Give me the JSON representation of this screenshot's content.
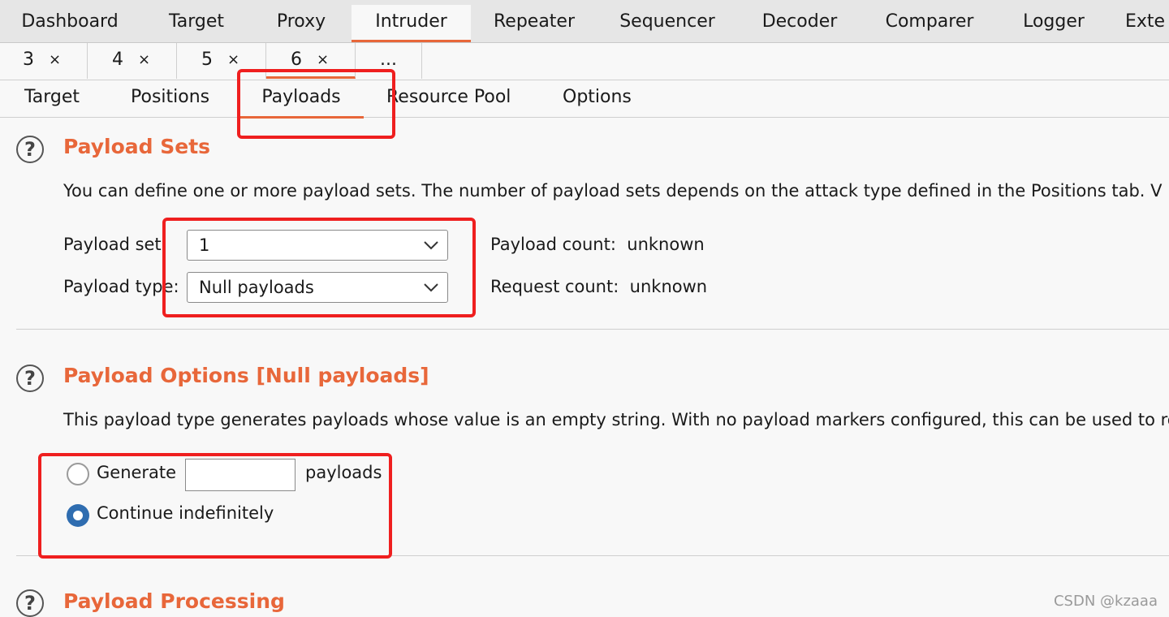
{
  "top_tabs": [
    "Dashboard",
    "Target",
    "Proxy",
    "Intruder",
    "Repeater",
    "Sequencer",
    "Decoder",
    "Comparer",
    "Logger",
    "Exte"
  ],
  "active_top_tab": "Intruder",
  "attack_tabs": [
    {
      "num": "3",
      "close": "×"
    },
    {
      "num": "4",
      "close": "×"
    },
    {
      "num": "5",
      "close": "×"
    },
    {
      "num": "6",
      "close": "×"
    }
  ],
  "attack_tabs_more": "...",
  "inner_tabs": [
    "Target",
    "Positions",
    "Payloads",
    "Resource Pool",
    "Options"
  ],
  "active_inner_tab": "Payloads",
  "help_glyph": "?",
  "payload_sets": {
    "title": "Payload Sets",
    "description": "You can define one or more payload sets. The number of payload sets depends on the attack type defined in the Positions tab. V",
    "set_label": "Payload set:",
    "set_value": "1",
    "type_label": "Payload type:",
    "type_value": "Null payloads",
    "payload_count_label": "Payload count:",
    "payload_count_value": "unknown",
    "request_count_label": "Request count:",
    "request_count_value": "unknown"
  },
  "payload_options": {
    "title": "Payload Options [Null payloads]",
    "description": "This payload type generates payloads whose value is an empty string. With no payload markers configured, this can be used to re",
    "generate_label": "Generate",
    "generate_value": "",
    "payloads_suffix": "payloads",
    "continue_label": "Continue indefinitely",
    "selected": "continue"
  },
  "payload_processing": {
    "title": "Payload Processing"
  },
  "watermark": "CSDN @kzaaa",
  "colors": {
    "accent": "#e8673a",
    "annotation": "#ef1f1f",
    "radio_selected": "#2f6db0"
  }
}
